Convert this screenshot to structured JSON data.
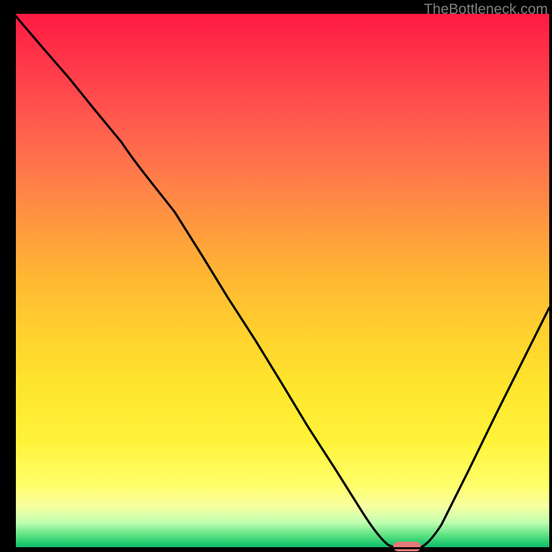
{
  "watermark": "TheBottleneck.com",
  "colors": {
    "background": "#000000",
    "curve": "#000000",
    "marker": "#e57878",
    "gradient_top": "#ff1a44",
    "gradient_bottom": "#10b868"
  },
  "chart_data": {
    "type": "line",
    "title": "",
    "xlabel": "",
    "ylabel": "",
    "xlim": [
      0,
      100
    ],
    "ylim": [
      0,
      100
    ],
    "x": [
      0,
      5,
      10,
      15,
      20,
      25,
      30,
      35,
      40,
      45,
      50,
      55,
      60,
      65,
      70,
      72,
      75,
      80,
      85,
      90,
      95,
      100
    ],
    "values": [
      100,
      94,
      88,
      82,
      76,
      71,
      63,
      55,
      47,
      39,
      31,
      23,
      15,
      8,
      2,
      0,
      0,
      8,
      18,
      28,
      38,
      48
    ],
    "marker": {
      "x_start": 70,
      "x_end": 75,
      "y": 0
    },
    "notes": "V-shaped bottleneck curve over a red-to-green vertical gradient; minimum (optimal zone) around x=70-75 near y=0, highlighted by a pink pill marker on the x-axis."
  }
}
